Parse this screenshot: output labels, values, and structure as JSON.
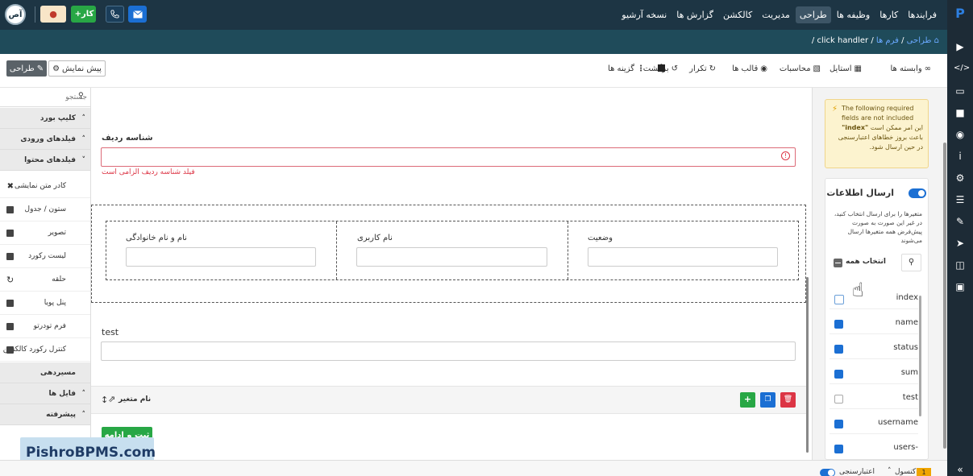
{
  "topbar": {
    "menu": [
      "فرایندها",
      "کارها",
      "وظیفه ها",
      "طراحی",
      "مدیریت",
      "کالکشن",
      "گزارش ها",
      "نسخه آرشیو"
    ],
    "active_menu": "طراحی",
    "user_initials": "آص",
    "add_task_label": "کار",
    "colors": {
      "bar": "#1d3544",
      "green": "#28a745",
      "blue": "#1b6fd3"
    }
  },
  "breadcrumb": {
    "home": "طراحی",
    "sep1": "/",
    "forms": "فرم ها",
    "sep2": "/",
    "current": "click handler",
    "sep3": "/"
  },
  "toolbar": {
    "items": [
      "وابسته ها",
      "استایل",
      "محاسبات",
      "قالب ها",
      "تکرار",
      "برگشت"
    ],
    "options": "گزینه ها",
    "preview": "پیش نمایش",
    "design": "طراحی"
  },
  "left_panel": {
    "search_placeholder": "جستجو",
    "sections": {
      "clipboard": "کلیپ بورد",
      "input_fields": "فیلدهای ورودی",
      "content_fields": "فیلدهای محتوا",
      "routing": "مسیردهی",
      "files": "فایل ها",
      "advanced": "پیشرفته"
    },
    "items": [
      "کادر متن نمایشی",
      "ستون / جدول",
      "تصویر",
      "لیست رکورد",
      "حلقه",
      "پنل پویا",
      "فرم تودرتو",
      "کنترل رکورد کالکشن"
    ]
  },
  "form": {
    "row_id_label": "شناسه ردیف",
    "row_id_error": "فیلد شناسه ردیف الزامی است",
    "columns": [
      "نام و نام خانوادگی",
      "نام کاربری",
      "وضعیت"
    ],
    "test_label": "test",
    "variable_name": "نام متغیر",
    "submit_label": "ثبت و ادامه"
  },
  "settings": {
    "warning_en": "The following required fields are not included",
    "warning_fa_1": "این امر ممکن است",
    "warning_field": "\"index\"",
    "warning_fa_2": "باعث بروز خطاهای اعتبارسنجی در حین ارسال شود.",
    "send_title": "ارسال اطلاعات",
    "send_desc": "متغیرها را برای ارسال انتخاب کنید، در غیر این صورت به صورت پیش‌فرض همه متغیرها ارسال می‌شوند",
    "select_all": "انتخاب همه",
    "variables": [
      {
        "name": "index",
        "checked": false
      },
      {
        "name": "name",
        "checked": true
      },
      {
        "name": "status",
        "checked": true
      },
      {
        "name": "sum",
        "checked": true
      },
      {
        "name": "test",
        "checked": false
      },
      {
        "name": "username",
        "checked": true
      },
      {
        "name": "users-",
        "checked": true
      }
    ]
  },
  "statusbar": {
    "console": "کنسول",
    "console_count": "1",
    "validation": "اعتبارسنجی"
  },
  "watermark": "PishroBPMS.com"
}
